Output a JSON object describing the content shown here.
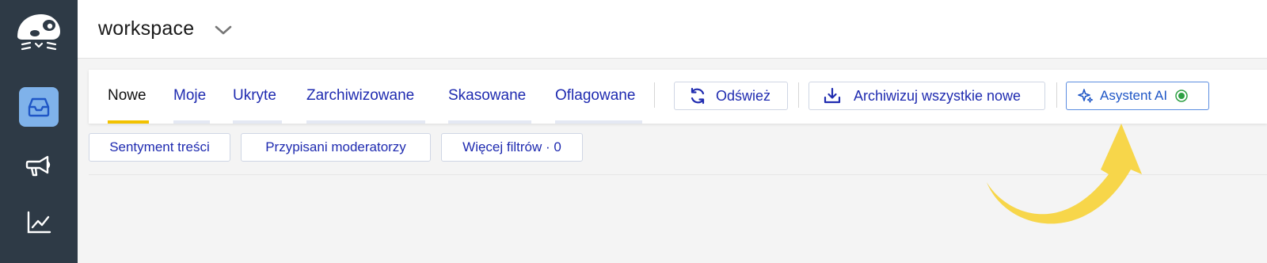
{
  "app": {
    "workspace_title": "workspace"
  },
  "sidebar": {
    "items": [
      {
        "icon": "inbox-icon",
        "active": true
      },
      {
        "icon": "megaphone-icon",
        "active": false
      },
      {
        "icon": "chart-line-icon",
        "active": false
      }
    ]
  },
  "tabs": [
    {
      "label": "Nowe",
      "active": true
    },
    {
      "label": "Moje",
      "active": false
    },
    {
      "label": "Ukryte",
      "active": false
    },
    {
      "label": "Zarchiwizowane",
      "active": false
    },
    {
      "label": "Skasowane",
      "active": false
    },
    {
      "label": "Oflagowane",
      "active": false
    }
  ],
  "toolbar": {
    "refresh_label": "Odśwież",
    "archive_all_label": "Archiwizuj wszystkie nowe",
    "ai_assistant_label": "Asystent AI"
  },
  "filters": [
    {
      "label": "Sentyment treści"
    },
    {
      "label": "Przypisani moderatorzy"
    },
    {
      "label": "Więcej filtrów · 0"
    }
  ],
  "colors": {
    "sidebar_bg": "#2e3a46",
    "active_item_bg": "#7fb2ea",
    "link_blue": "#1f2bb0",
    "active_tab_underline": "#f2c200",
    "annotation_arrow": "#f7d64a",
    "status_dot": "#2ea043"
  }
}
